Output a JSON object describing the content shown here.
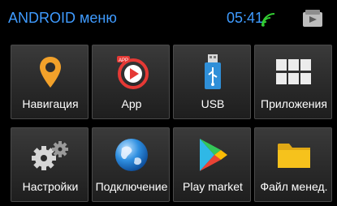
{
  "header": {
    "title": "ANDROID меню",
    "time": "05:41"
  },
  "icons": {
    "wifi": "wifi-icon",
    "store": "play-store-bag-icon"
  },
  "colors": {
    "header_text": "#3f9bff",
    "wifi": "#33cc33",
    "folder": "#f6c21c",
    "pin": "#f2a12a"
  },
  "apps": [
    {
      "label": "Навигация",
      "icon": "location-pin-icon"
    },
    {
      "label": "App",
      "icon": "app-play-icon"
    },
    {
      "label": "USB",
      "icon": "usb-drive-icon"
    },
    {
      "label": "Приложения",
      "icon": "app-grid-icon"
    },
    {
      "label": "Настройки",
      "icon": "gears-icon"
    },
    {
      "label": "Подключение",
      "icon": "globe-icon"
    },
    {
      "label": "Play market",
      "icon": "play-market-icon"
    },
    {
      "label": "Файл менед.",
      "icon": "folder-icon"
    }
  ]
}
